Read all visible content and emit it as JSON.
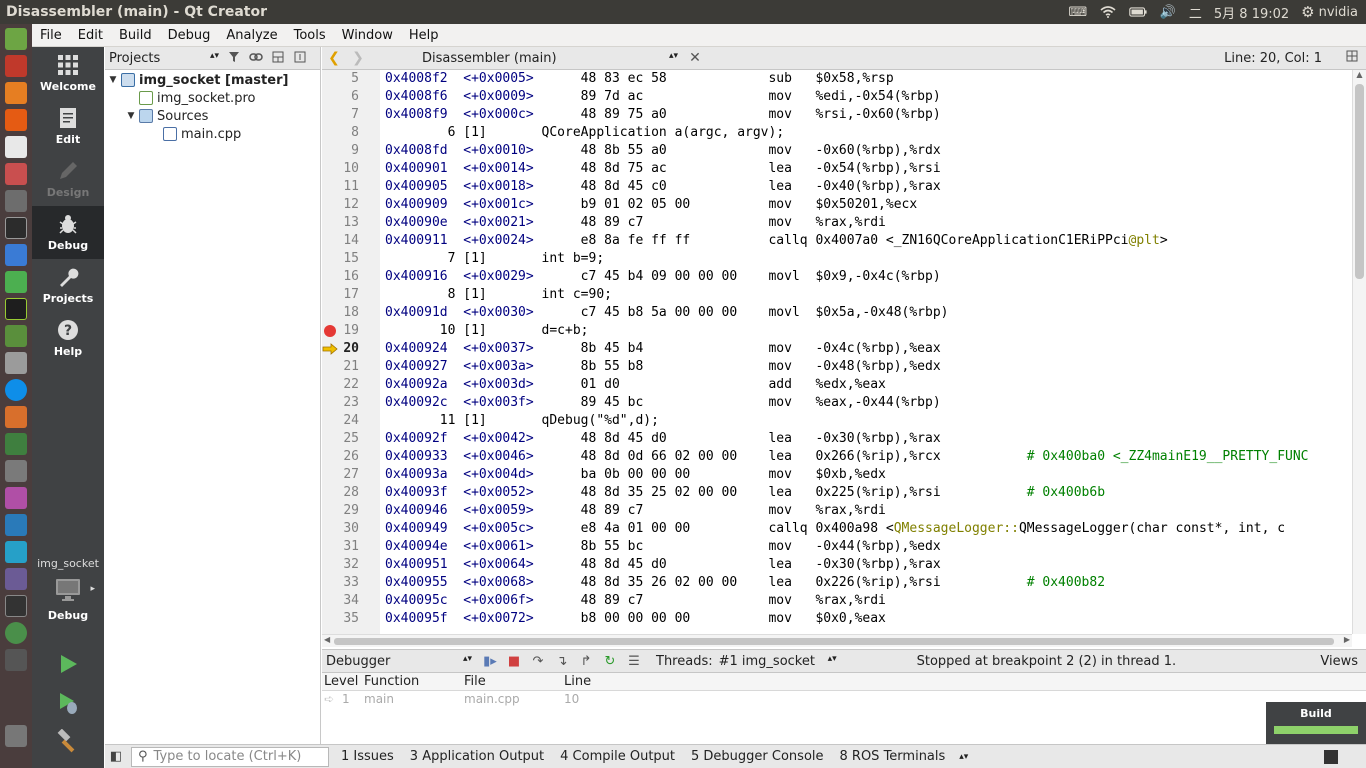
{
  "topbar": {
    "title": "Disassembler (main) - Qt Creator",
    "ime": "二",
    "date": "5月  8 19:02",
    "user": "nvidia"
  },
  "menubar": {
    "items": [
      {
        "label": "File"
      },
      {
        "label": "Edit"
      },
      {
        "label": "Build"
      },
      {
        "label": "Debug"
      },
      {
        "label": "Analyze"
      },
      {
        "label": "Tools"
      },
      {
        "label": "Window"
      },
      {
        "label": "Help"
      }
    ]
  },
  "modes": [
    {
      "label": "Welcome",
      "icon": "grid-icon"
    },
    {
      "label": "Edit",
      "icon": "document-icon"
    },
    {
      "label": "Design",
      "icon": "pencil-icon"
    },
    {
      "label": "Debug",
      "icon": "bug-icon"
    },
    {
      "label": "Projects",
      "icon": "wrench-icon"
    },
    {
      "label": "Help",
      "icon": "help-icon"
    }
  ],
  "kit": {
    "project": "img_socket",
    "mode": "Debug"
  },
  "projects": {
    "combo": "Projects",
    "tree": [
      {
        "label": "img_socket [master]",
        "level": 0,
        "bold": true,
        "expanded": true
      },
      {
        "label": "img_socket.pro",
        "level": 1
      },
      {
        "label": "Sources",
        "level": 1,
        "expanded": true
      },
      {
        "label": "main.cpp",
        "level": 2
      }
    ]
  },
  "editor": {
    "doc_title": "Disassembler (main)",
    "position": "Line: 20, Col: 1",
    "lines": [
      {
        "n": "5",
        "addr": "0x4008f2",
        "off": "<+0x0005>",
        "bytes": "48 83 ec 58",
        "mn": "sub",
        "ops": "$0x58,%rsp"
      },
      {
        "n": "6",
        "addr": "0x4008f6",
        "off": "<+0x0009>",
        "bytes": "89 7d ac",
        "mn": "mov",
        "ops": "%edi,-0x54(%rbp)"
      },
      {
        "n": "7",
        "addr": "0x4008f9",
        "off": "<+0x000c>",
        "bytes": "48 89 75 a0",
        "mn": "mov",
        "ops": "%rsi,-0x60(%rbp)"
      },
      {
        "n": "8",
        "srcline": "        6 [1]       QCoreApplication a(argc, argv);"
      },
      {
        "n": "9",
        "addr": "0x4008fd",
        "off": "<+0x0010>",
        "bytes": "48 8b 55 a0",
        "mn": "mov",
        "ops": "-0x60(%rbp),%rdx"
      },
      {
        "n": "10",
        "addr": "0x400901",
        "off": "<+0x0014>",
        "bytes": "48 8d 75 ac",
        "mn": "lea",
        "ops": "-0x54(%rbp),%rsi"
      },
      {
        "n": "11",
        "addr": "0x400905",
        "off": "<+0x0018>",
        "bytes": "48 8d 45 c0",
        "mn": "lea",
        "ops": "-0x40(%rbp),%rax"
      },
      {
        "n": "12",
        "addr": "0x400909",
        "off": "<+0x001c>",
        "bytes": "b9 01 02 05 00",
        "mn": "mov",
        "ops": "$0x50201,%ecx"
      },
      {
        "n": "13",
        "addr": "0x40090e",
        "off": "<+0x0021>",
        "bytes": "48 89 c7",
        "mn": "mov",
        "ops": "%rax,%rdi"
      },
      {
        "n": "14",
        "addr": "0x400911",
        "off": "<+0x0024>",
        "bytes": "e8 8a fe ff ff",
        "mn": "callq",
        "ops": "0x4007a0 <_ZN16QCoreApplicationC1ERiPPci",
        "sym": "@plt",
        "tail": ">"
      },
      {
        "n": "15",
        "srcline": "        7 [1]       int b=9;"
      },
      {
        "n": "16",
        "addr": "0x400916",
        "off": "<+0x0029>",
        "bytes": "c7 45 b4 09 00 00 00",
        "mn": "movl",
        "ops": "$0x9,-0x4c(%rbp)"
      },
      {
        "n": "17",
        "srcline": "        8 [1]       int c=90;"
      },
      {
        "n": "18",
        "addr": "0x40091d",
        "off": "<+0x0030>",
        "bytes": "c7 45 b8 5a 00 00 00",
        "mn": "movl",
        "ops": "$0x5a,-0x48(%rbp)"
      },
      {
        "n": "19",
        "srcline": "       10 [1]       d=c+b;",
        "marker": "breakpoint"
      },
      {
        "n": "20",
        "addr": "0x400924",
        "off": "<+0x0037>",
        "bytes": "8b 45 b4",
        "mn": "mov",
        "ops": "-0x4c(%rbp),%eax",
        "marker": "current"
      },
      {
        "n": "21",
        "addr": "0x400927",
        "off": "<+0x003a>",
        "bytes": "8b 55 b8",
        "mn": "mov",
        "ops": "-0x48(%rbp),%edx"
      },
      {
        "n": "22",
        "addr": "0x40092a",
        "off": "<+0x003d>",
        "bytes": "01 d0",
        "mn": "add",
        "ops": "%edx,%eax"
      },
      {
        "n": "23",
        "addr": "0x40092c",
        "off": "<+0x003f>",
        "bytes": "89 45 bc",
        "mn": "mov",
        "ops": "%eax,-0x44(%rbp)"
      },
      {
        "n": "24",
        "srcline": "       11 [1]       qDebug(\"%d\",d);"
      },
      {
        "n": "25",
        "addr": "0x40092f",
        "off": "<+0x0042>",
        "bytes": "48 8d 45 d0",
        "mn": "lea",
        "ops": "-0x30(%rbp),%rax"
      },
      {
        "n": "26",
        "addr": "0x400933",
        "off": "<+0x0046>",
        "bytes": "48 8d 0d 66 02 00 00",
        "mn": "lea",
        "ops": "0x266(%rip),%rcx",
        "comment": "# 0x400ba0 <_ZZ4mainE19__PRETTY_FUNC"
      },
      {
        "n": "27",
        "addr": "0x40093a",
        "off": "<+0x004d>",
        "bytes": "ba 0b 00 00 00",
        "mn": "mov",
        "ops": "$0xb,%edx"
      },
      {
        "n": "28",
        "addr": "0x40093f",
        "off": "<+0x0052>",
        "bytes": "48 8d 35 25 02 00 00",
        "mn": "lea",
        "ops": "0x225(%rip),%rsi",
        "comment": "# 0x400b6b"
      },
      {
        "n": "29",
        "addr": "0x400946",
        "off": "<+0x0059>",
        "bytes": "48 89 c7",
        "mn": "mov",
        "ops": "%rax,%rdi"
      },
      {
        "n": "30",
        "addr": "0x400949",
        "off": "<+0x005c>",
        "bytes": "e8 4a 01 00 00",
        "mn": "callq",
        "ops": "0x400a98 <",
        "sym": "QMessageLogger::",
        "tail": "QMessageLogger(char const*, int, c"
      },
      {
        "n": "31",
        "addr": "0x40094e",
        "off": "<+0x0061>",
        "bytes": "8b 55 bc",
        "mn": "mov",
        "ops": "-0x44(%rbp),%edx"
      },
      {
        "n": "32",
        "addr": "0x400951",
        "off": "<+0x0064>",
        "bytes": "48 8d 45 d0",
        "mn": "lea",
        "ops": "-0x30(%rbp),%rax"
      },
      {
        "n": "33",
        "addr": "0x400955",
        "off": "<+0x0068>",
        "bytes": "48 8d 35 26 02 00 00",
        "mn": "lea",
        "ops": "0x226(%rip),%rsi",
        "comment": "# 0x400b82"
      },
      {
        "n": "34",
        "addr": "0x40095c",
        "off": "<+0x006f>",
        "bytes": "48 89 c7",
        "mn": "mov",
        "ops": "%rax,%rdi"
      },
      {
        "n": "35",
        "addr": "0x40095f",
        "off": "<+0x0072>",
        "bytes": "b8 00 00 00 00",
        "mn": "mov",
        "ops": "$0x0,%eax"
      }
    ]
  },
  "debugger": {
    "combo": "Debugger",
    "threads_label": "Threads:",
    "thread": "#1 img_socket",
    "status": "Stopped at breakpoint 2 (2) in thread 1.",
    "views": "Views",
    "stack_headers": [
      "Level",
      "Function",
      "File",
      "Line"
    ],
    "stack_rows": [
      {
        "level": "1",
        "function": "main",
        "file": "main.cpp",
        "line": "10"
      }
    ]
  },
  "build": {
    "label": "Build",
    "progress": 1.0,
    "color": "#8ed16a"
  },
  "bottombar": {
    "locator_placeholder": "Type to locate (Ctrl+K)",
    "tabs": [
      {
        "label": "1  Issues"
      },
      {
        "label": "3  Application Output"
      },
      {
        "label": "4  Compile Output"
      },
      {
        "label": "5  Debugger Console"
      },
      {
        "label": "8  ROS Terminals"
      }
    ]
  },
  "colors": {
    "accent_green": "#4caf50",
    "breakpoint": "#e53935",
    "arrow": "#f0c000"
  }
}
